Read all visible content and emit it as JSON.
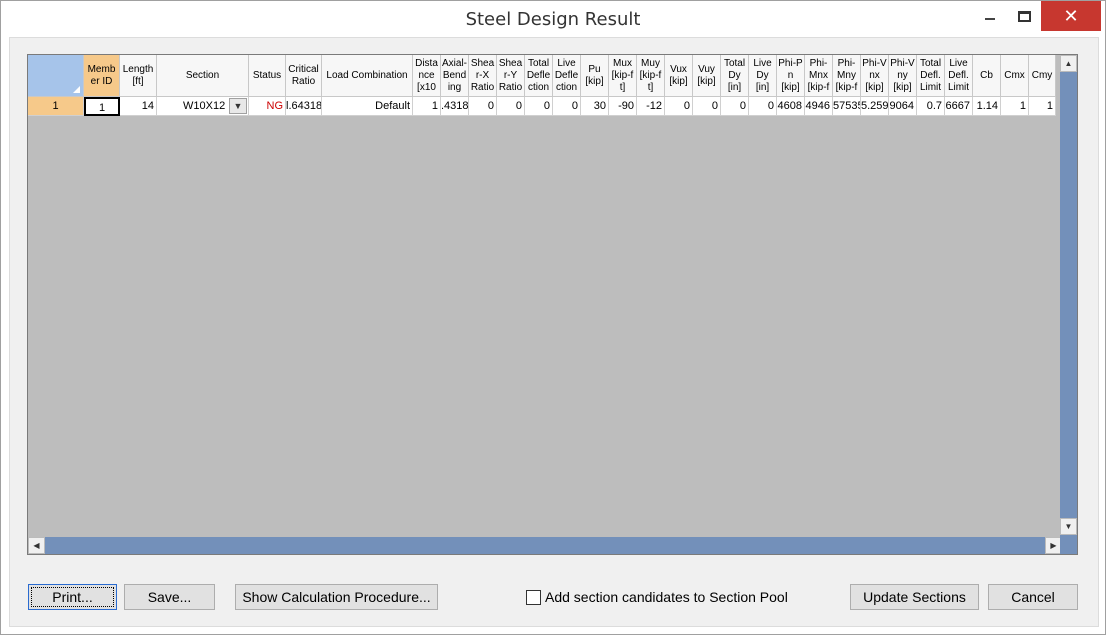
{
  "window": {
    "title": "Steel Design Result",
    "close_glyph": "✕"
  },
  "grid": {
    "columns": [
      {
        "key": "corner",
        "label": "",
        "width": 56
      },
      {
        "key": "member_id",
        "label": "Memb er ID",
        "width": 36
      },
      {
        "key": "length",
        "label": "Length [ft]",
        "width": 37
      },
      {
        "key": "section",
        "label": "Section",
        "width": 92
      },
      {
        "key": "status",
        "label": "Status",
        "width": 37
      },
      {
        "key": "critical_ratio",
        "label": "Critical Ratio",
        "width": 36
      },
      {
        "key": "load_combination",
        "label": "Load Combination",
        "width": 91
      },
      {
        "key": "distance",
        "label": "Dista nce [x10",
        "width": 28
      },
      {
        "key": "axial_bending",
        "label": "Axial- Bend ing",
        "width": 28
      },
      {
        "key": "shear_x_ratio",
        "label": "Shea r-X Ratio",
        "width": 28
      },
      {
        "key": "shear_y_ratio",
        "label": "Shea r-Y Ratio",
        "width": 28
      },
      {
        "key": "total_deflection",
        "label": "Total Defle ction",
        "width": 28
      },
      {
        "key": "live_deflection",
        "label": "Live Defle ction",
        "width": 28
      },
      {
        "key": "pu",
        "label": "Pu [kip]",
        "width": 28
      },
      {
        "key": "mux",
        "label": "Mux [kip-f t]",
        "width": 28
      },
      {
        "key": "muy",
        "label": "Muy [kip-f t]",
        "width": 28
      },
      {
        "key": "vux",
        "label": "Vux [kip]",
        "width": 28
      },
      {
        "key": "vuy",
        "label": "Vuy [kip]",
        "width": 28
      },
      {
        "key": "total_dy",
        "label": "Total Dy [in]",
        "width": 28
      },
      {
        "key": "live_dy",
        "label": "Live Dy [in]",
        "width": 28
      },
      {
        "key": "phi_pn",
        "label": "Phi-P n [kip]",
        "width": 28
      },
      {
        "key": "phi_mnx",
        "label": "Phi- Mnx [kip-f",
        "width": 28
      },
      {
        "key": "phi_mny",
        "label": "Phi- Mny [kip-f",
        "width": 28
      },
      {
        "key": "phi_vnx",
        "label": "Phi-V nx [kip]",
        "width": 28
      },
      {
        "key": "phi_vny",
        "label": "Phi-V ny [kip]",
        "width": 28
      },
      {
        "key": "total_defl_limit",
        "label": "Total Defl. Limit",
        "width": 28
      },
      {
        "key": "live_defl_limit",
        "label": "Live Defl. Limit",
        "width": 28
      },
      {
        "key": "cb",
        "label": "Cb",
        "width": 28
      },
      {
        "key": "cmx",
        "label": "Cmx",
        "width": 28
      },
      {
        "key": "cmy",
        "label": "Cmy",
        "width": 27
      }
    ],
    "rows": [
      {
        "row_header": "1",
        "member_id": "1",
        "length": "14",
        "section": "W10X12",
        "status": "NG",
        "critical_ratio": "l.64318",
        "load_combination": "Default",
        "distance": "1",
        "axial_bending": ".4318",
        "shear_x_ratio": "0",
        "shear_y_ratio": "0",
        "total_deflection": "0",
        "live_deflection": "0",
        "pu": "30",
        "mux": "-90",
        "muy": "-12",
        "vux": "0",
        "vuy": "0",
        "total_dy": "0",
        "live_dy": "0",
        "phi_pn": "4608",
        "phi_mnx": "4946",
        "phi_mny": "57535",
        "phi_vnx": "5.259",
        "phi_vny": "9064",
        "total_defl_limit": "0.7",
        "live_defl_limit": "6667",
        "cb": "1.14",
        "cmx": "1",
        "cmy": "1"
      }
    ]
  },
  "buttons": {
    "print": "Print...",
    "save": "Save...",
    "calc": "Show Calculation Procedure...",
    "update": "Update Sections",
    "cancel": "Cancel"
  },
  "checkbox": {
    "label": "Add section candidates to Section Pool",
    "checked": false
  },
  "colors": {
    "selected_header": "#f6c98a",
    "corner_header": "#a6c4ea",
    "status_ng": "#cc0000",
    "scrollbar": "#7390ba",
    "grid_empty": "#bdbdbd"
  }
}
